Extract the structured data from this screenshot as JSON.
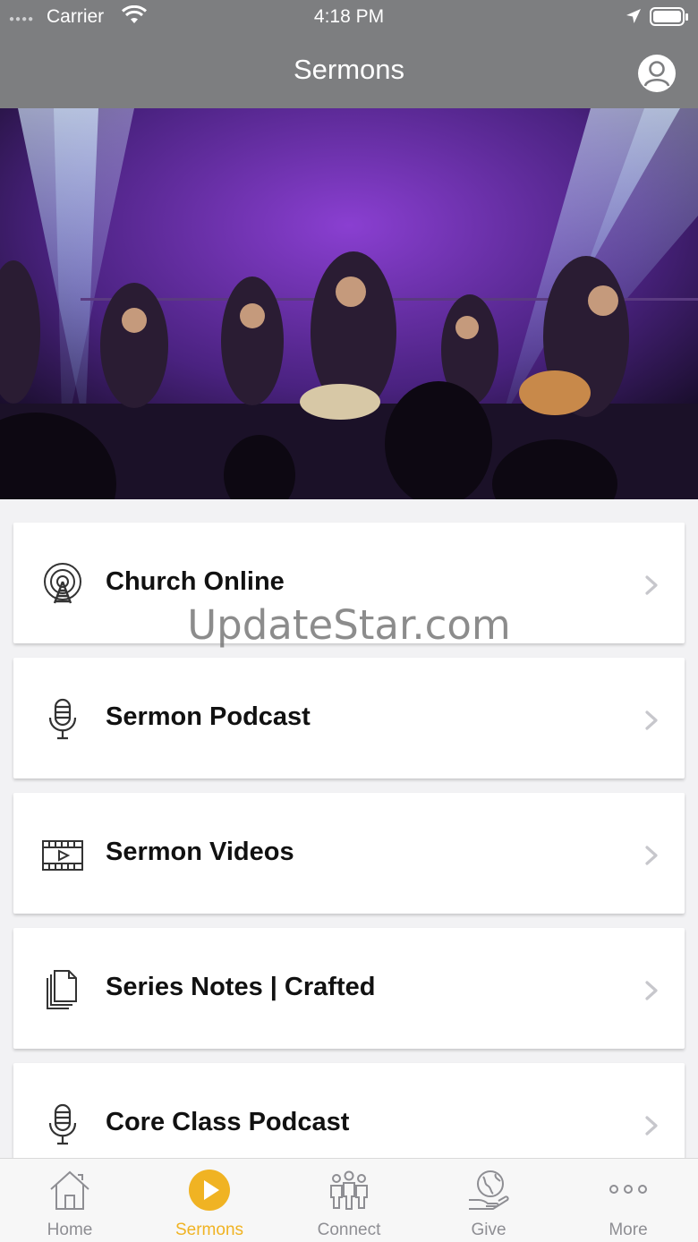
{
  "status_bar": {
    "carrier": "Carrier",
    "time": "4:18 PM"
  },
  "nav": {
    "title": "Sermons"
  },
  "watermark": "UpdateStar.com",
  "menu": [
    {
      "label": "Church Online",
      "icon": "broadcast-tower-icon"
    },
    {
      "label": "Sermon Podcast",
      "icon": "microphone-icon"
    },
    {
      "label": "Sermon Videos",
      "icon": "video-film-icon"
    },
    {
      "label": "Series Notes | Crafted",
      "icon": "documents-icon"
    },
    {
      "label": "Core Class Podcast",
      "icon": "microphone-icon"
    }
  ],
  "tabs": [
    {
      "label": "Home",
      "icon": "home-icon",
      "active": false
    },
    {
      "label": "Sermons",
      "icon": "play-circle-icon",
      "active": true
    },
    {
      "label": "Connect",
      "icon": "people-icon",
      "active": false
    },
    {
      "label": "Give",
      "icon": "give-hand-icon",
      "active": false
    },
    {
      "label": "More",
      "icon": "more-dots-icon",
      "active": false
    }
  ],
  "colors": {
    "nav_bar": "#7d7e80",
    "accent": "#f0b323",
    "tab_inactive": "#8e8e93",
    "background": "#f2f2f4"
  }
}
